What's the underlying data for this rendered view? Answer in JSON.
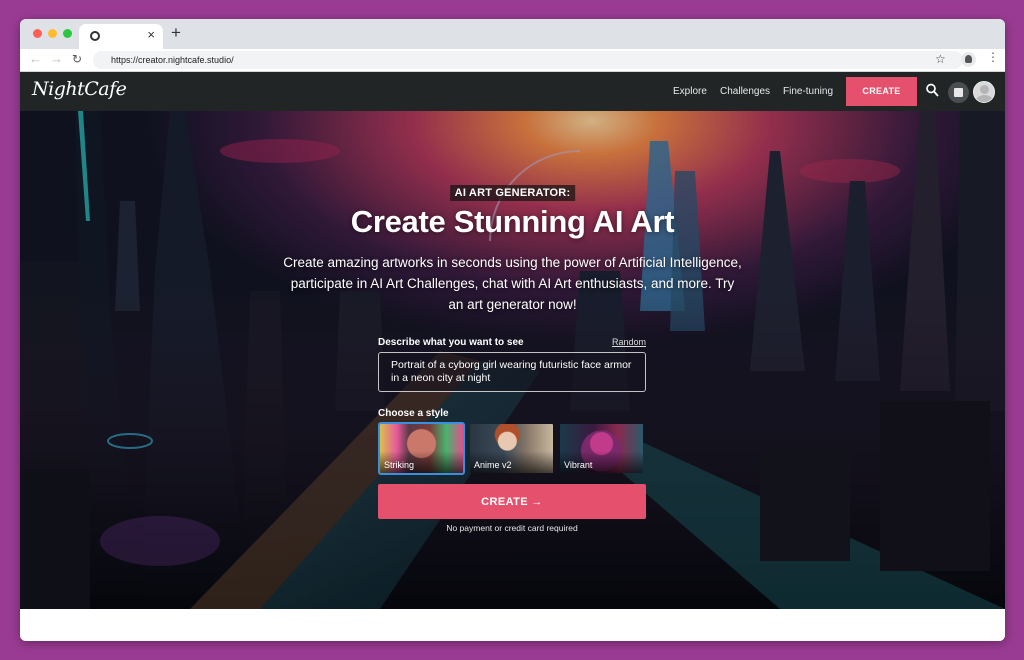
{
  "browser": {
    "tab_close": "×",
    "new_tab": "+",
    "url": "https://creator.nightcafe.studio/",
    "back": "←",
    "forward": "→",
    "reload": "↻",
    "star": "☆",
    "menu": "⋮"
  },
  "header": {
    "logo": "NightCafe",
    "nav": [
      {
        "label": "Explore"
      },
      {
        "label": "Challenges"
      },
      {
        "label": "Fine-tuning"
      }
    ],
    "create_label": "CREATE"
  },
  "hero": {
    "eyebrow": "AI ART GENERATOR:",
    "title": "Create Stunning AI Art",
    "subtitle": "Create amazing artworks in seconds using the power of Artificial Intelligence, participate in AI Art Challenges, chat with AI Art enthusiasts, and more. Try an art generator now!"
  },
  "form": {
    "prompt_label": "Describe what you want to see",
    "random_label": "Random",
    "prompt_value": "Portrait of a cyborg girl wearing futuristic face armor in a neon city at night",
    "style_label": "Choose a style",
    "styles": [
      {
        "name": "Striking",
        "selected": true
      },
      {
        "name": "Anime v2",
        "selected": false
      },
      {
        "name": "Vibrant",
        "selected": false
      }
    ],
    "create_label": "CREATE →",
    "note": "No payment or credit card required"
  },
  "colors": {
    "accent": "#e5506c",
    "header_bg": "#212526",
    "page_bg": "#9a3b93",
    "selected_style": "#3b8fe0"
  }
}
